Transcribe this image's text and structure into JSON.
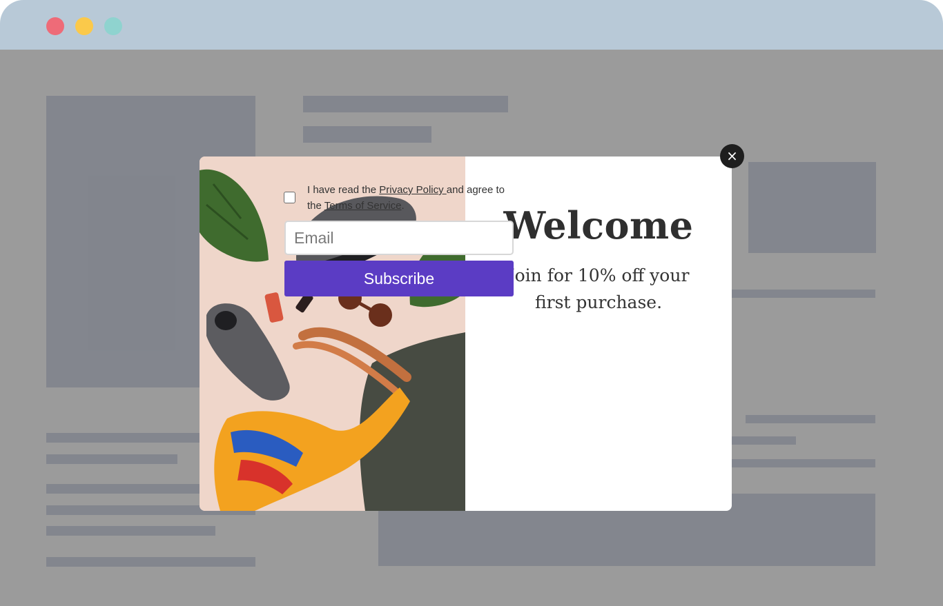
{
  "window": {
    "controls": [
      "close-dot",
      "minimize-dot",
      "maximize-dot"
    ],
    "colors": {
      "close": "#ee6b78",
      "minimize": "#fbc94a",
      "maximize": "#8fd3cf",
      "titlebar": "#b8c9d7"
    }
  },
  "popup": {
    "image_alt": "Flat lay of sneakers, sunglasses, lipstick, leather tote bag, silk scarf and monstera leaves",
    "title": "Welcome",
    "subtitle_line1": "Join for 10% off your",
    "subtitle_line2": "first purchase.",
    "consent": {
      "checked": false,
      "prefix": "I have read the ",
      "privacy_link": "Privacy Policy ",
      "middle": "and agree to the ",
      "terms_link": "Terms of Service",
      "suffix": "."
    },
    "email_placeholder": "Email",
    "email_value": "",
    "subscribe_label": "Subscribe",
    "close_label": "×",
    "accent_color": "#5b3cc4"
  }
}
